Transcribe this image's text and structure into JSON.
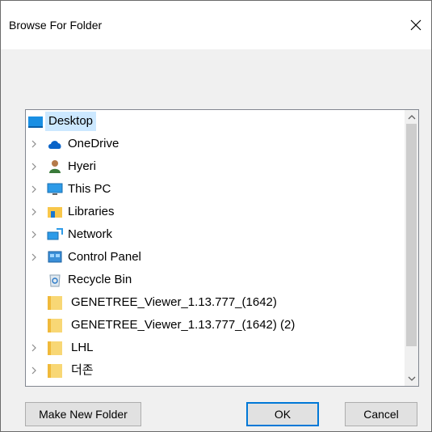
{
  "dialog": {
    "title": "Browse For Folder",
    "close_icon": "close-icon"
  },
  "tree": {
    "items": [
      {
        "label": "Desktop",
        "icon": "desktop-icon",
        "expandable": false,
        "selected": true
      },
      {
        "label": "OneDrive",
        "icon": "cloud-icon",
        "expandable": true
      },
      {
        "label": "Hyeri",
        "icon": "user-icon",
        "expandable": true
      },
      {
        "label": "This PC",
        "icon": "monitor-icon",
        "expandable": true
      },
      {
        "label": "Libraries",
        "icon": "libraries-icon",
        "expandable": true
      },
      {
        "label": "Network",
        "icon": "network-icon",
        "expandable": true
      },
      {
        "label": "Control Panel",
        "icon": "control-panel-icon",
        "expandable": true
      },
      {
        "label": "Recycle Bin",
        "icon": "recycle-bin-icon",
        "expandable": false
      },
      {
        "label": "GENETREE_Viewer_1.13.777_(1642)",
        "icon": "folder-icon",
        "expandable": false
      },
      {
        "label": "GENETREE_Viewer_1.13.777_(1642) (2)",
        "icon": "folder-icon",
        "expandable": false
      },
      {
        "label": "LHL",
        "icon": "folder-icon",
        "expandable": true
      },
      {
        "label": "더존",
        "icon": "folder-icon",
        "expandable": true
      }
    ]
  },
  "buttons": {
    "make_new_folder": "Make New Folder",
    "ok": "OK",
    "cancel": "Cancel"
  },
  "colors": {
    "accent": "#0078d7",
    "selection": "#cce8ff",
    "folder": "#f8d775"
  }
}
